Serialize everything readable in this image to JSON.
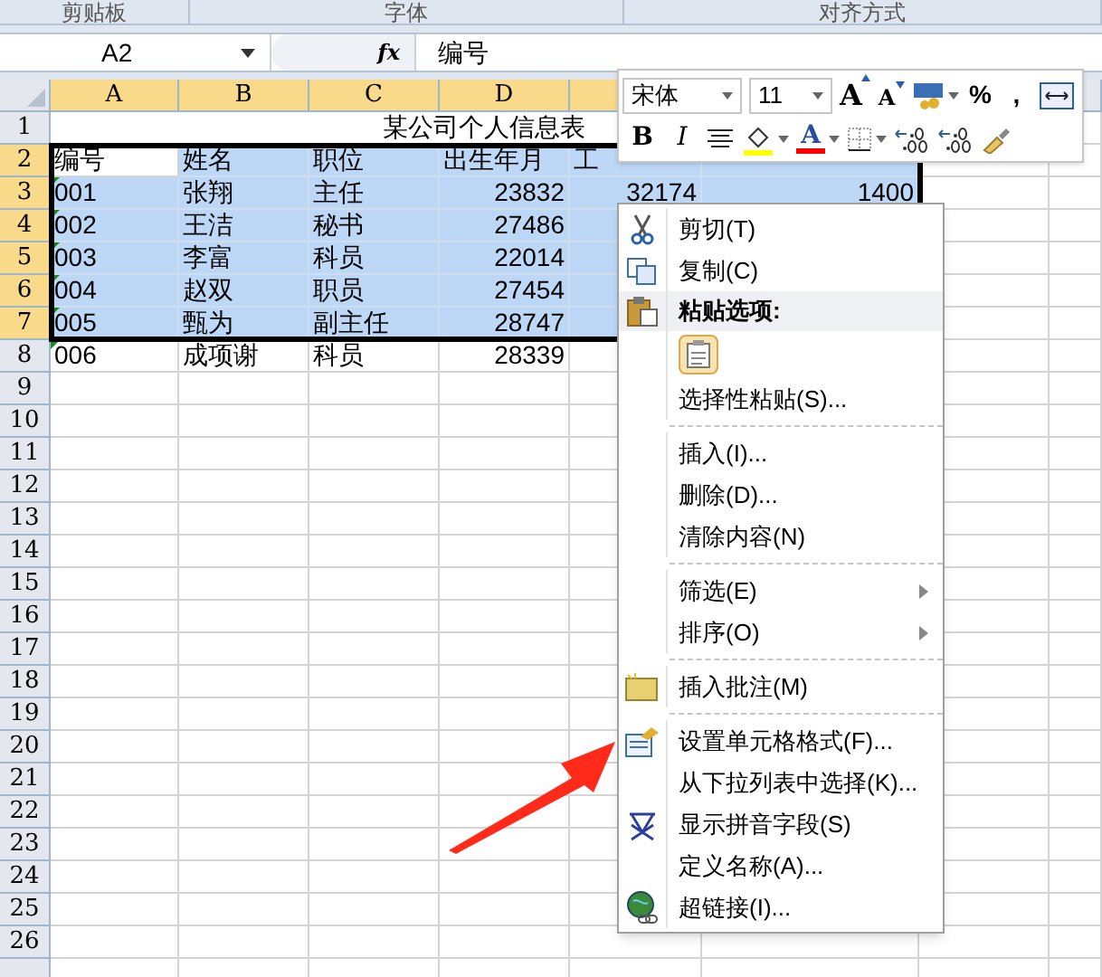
{
  "ribbon_groups": [
    "剪贴板",
    "字体",
    "对齐方式"
  ],
  "name_box": "A2",
  "formula_bar": {
    "fx": "fx",
    "value": "编号"
  },
  "columns": [
    {
      "label": "A",
      "selected": true
    },
    {
      "label": "B",
      "selected": true
    },
    {
      "label": "C",
      "selected": true
    },
    {
      "label": "D",
      "selected": true
    }
  ],
  "rows": [
    {
      "number": "1",
      "selected": false,
      "title": "某公司个人信息表"
    },
    {
      "number": "2",
      "selected": true,
      "kind": "header",
      "cells": [
        "编号",
        "姓名",
        "职位",
        "出生年月",
        "工"
      ]
    },
    {
      "number": "3",
      "selected": true,
      "kind": "record",
      "flagged": true,
      "cells": [
        "001",
        "张翔",
        "主任",
        "23832",
        "32174",
        "1400"
      ]
    },
    {
      "number": "4",
      "selected": true,
      "kind": "record",
      "flagged": true,
      "cells": [
        "002",
        "王洁",
        "秘书",
        "27486"
      ]
    },
    {
      "number": "5",
      "selected": true,
      "kind": "record",
      "flagged": true,
      "cells": [
        "003",
        "李富",
        "科员",
        "22014"
      ]
    },
    {
      "number": "6",
      "selected": true,
      "kind": "record",
      "flagged": true,
      "cells": [
        "004",
        "赵双",
        "职员",
        "27454"
      ]
    },
    {
      "number": "7",
      "selected": true,
      "kind": "record",
      "flagged": true,
      "cells": [
        "005",
        "甄为",
        "副主任",
        "28747"
      ]
    },
    {
      "number": "8",
      "selected": false,
      "kind": "record",
      "flagged": true,
      "cells": [
        "006",
        "成项谢",
        "科员",
        "28339"
      ]
    },
    {
      "number": "9",
      "selected": false
    },
    {
      "number": "10",
      "selected": false
    },
    {
      "number": "11",
      "selected": false
    },
    {
      "number": "12",
      "selected": false
    },
    {
      "number": "13",
      "selected": false
    },
    {
      "number": "14",
      "selected": false
    },
    {
      "number": "15",
      "selected": false
    },
    {
      "number": "16",
      "selected": false
    },
    {
      "number": "17",
      "selected": false
    },
    {
      "number": "18",
      "selected": false
    },
    {
      "number": "19",
      "selected": false
    },
    {
      "number": "20",
      "selected": false
    },
    {
      "number": "21",
      "selected": false
    },
    {
      "number": "22",
      "selected": false
    },
    {
      "number": "23",
      "selected": false
    },
    {
      "number": "24",
      "selected": false
    },
    {
      "number": "25",
      "selected": false
    },
    {
      "number": "26",
      "selected": false
    }
  ],
  "mini_toolbar": {
    "font": "宋体",
    "size": "11",
    "row_1": [
      {
        "kind": "grow",
        "label": "A"
      },
      {
        "kind": "shrink",
        "label": "A"
      },
      {
        "kind": "accounting"
      },
      {
        "kind": "text",
        "label": "%"
      },
      {
        "kind": "text",
        "label": ","
      },
      {
        "kind": "merge"
      }
    ],
    "row_2": [
      {
        "kind": "bold",
        "label": "B"
      },
      {
        "kind": "italic",
        "label": "I"
      },
      {
        "kind": "center"
      },
      {
        "kind": "fill",
        "color": "#ffff00"
      },
      {
        "kind": "fontcolor",
        "label": "A",
        "color": "#ff0000"
      },
      {
        "kind": "borders"
      },
      {
        "kind": "incdec"
      },
      {
        "kind": "decdec"
      },
      {
        "kind": "painter"
      }
    ]
  },
  "context_menu": [
    {
      "kind": "item",
      "label": "剪切(T)"
    },
    {
      "kind": "item",
      "label": "复制(C)"
    },
    {
      "kind": "heading",
      "label": "粘贴选项:"
    },
    {
      "kind": "paste_option"
    },
    {
      "kind": "item",
      "label": "选择性粘贴(S)..."
    },
    {
      "kind": "separator"
    },
    {
      "kind": "item",
      "label": "插入(I)..."
    },
    {
      "kind": "item",
      "label": "删除(D)..."
    },
    {
      "kind": "item",
      "label": "清除内容(N)"
    },
    {
      "kind": "separator"
    },
    {
      "kind": "item",
      "label": "筛选(E)",
      "submenu": true
    },
    {
      "kind": "item",
      "label": "排序(O)",
      "submenu": true
    },
    {
      "kind": "separator"
    },
    {
      "kind": "item",
      "label": "插入批注(M)"
    },
    {
      "kind": "separator"
    },
    {
      "kind": "item",
      "label": "设置单元格格式(F)..."
    },
    {
      "kind": "item",
      "label": "从下拉列表中选择(K)..."
    },
    {
      "kind": "item",
      "label": "显示拼音字段(S)"
    },
    {
      "kind": "item",
      "label": "定义名称(A)..."
    },
    {
      "kind": "item",
      "label": "超链接(I)..."
    }
  ]
}
